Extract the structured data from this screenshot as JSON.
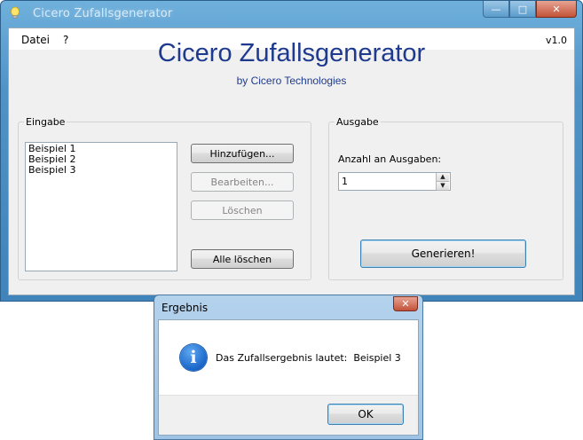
{
  "window": {
    "title": "Cicero Zufallsgenerator",
    "minimize_glyph": "—",
    "maximize_glyph": "□",
    "close_glyph": "✕"
  },
  "menu": {
    "items": [
      "Datei",
      "?"
    ],
    "version": "v1.0"
  },
  "header": {
    "title": "Cicero Zufallsgenerator",
    "subtitle": "by Cicero Technologies"
  },
  "input_group": {
    "legend": "Eingabe",
    "items": [
      "Beispiel 1",
      "Beispiel 2",
      "Beispiel 3"
    ],
    "add_label": "Hinzufügen...",
    "edit_label": "Bearbeiten...",
    "delete_label": "Löschen",
    "clear_all_label": "Alle löschen"
  },
  "output_group": {
    "legend": "Ausgabe",
    "count_label": "Anzahl an Ausgaben:",
    "count_value": "1",
    "generate_label": "Generieren!"
  },
  "dialog": {
    "title": "Ergebnis",
    "close_glyph": "✕",
    "icon": "info-icon",
    "icon_glyph": "i",
    "message": "Das Zufallsergebnis lautet:  Beispiel 3",
    "ok_label": "OK"
  },
  "colors": {
    "title_blue": "#1e3a8f",
    "window_frame": "#4f93c6",
    "close_red": "#c2533a",
    "info_blue": "#1a66c9"
  }
}
